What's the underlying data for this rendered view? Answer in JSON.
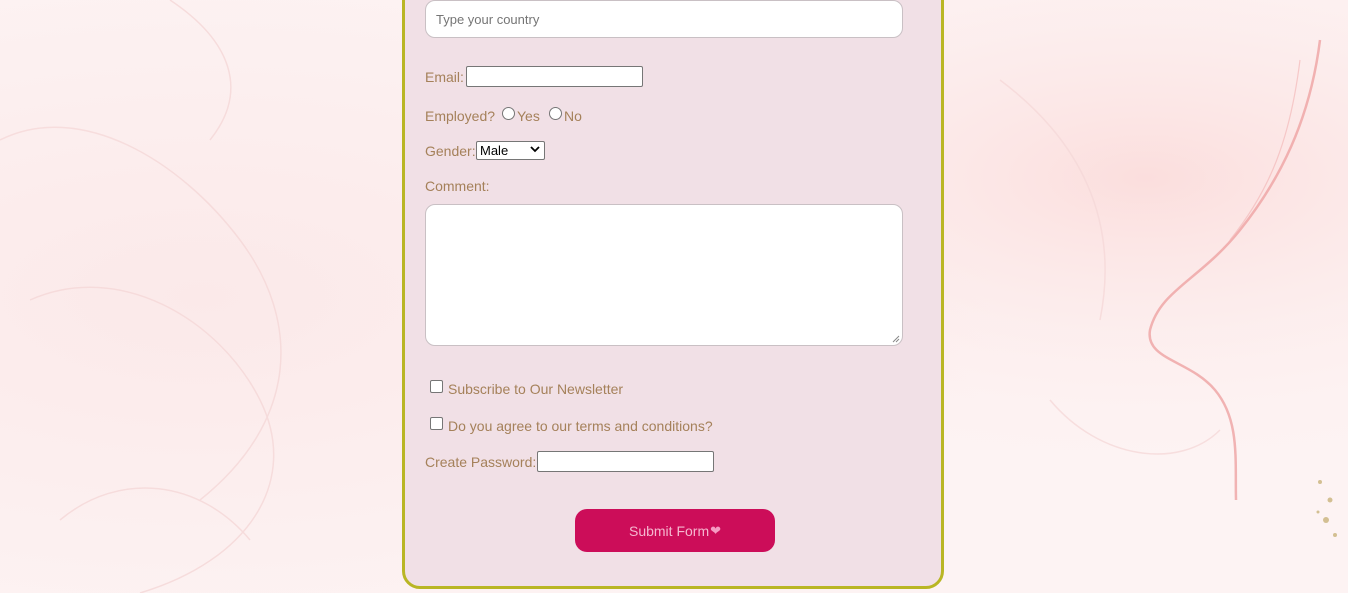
{
  "form": {
    "country": {
      "placeholder": "Type your country",
      "value": ""
    },
    "email": {
      "label": "Email:",
      "value": ""
    },
    "employed": {
      "label": "Employed?",
      "options": [
        "Yes",
        "No"
      ]
    },
    "gender": {
      "label": "Gender:",
      "selected": "Male"
    },
    "comment": {
      "label": "Comment:",
      "value": ""
    },
    "newsletter": {
      "label": "Subscribe to Our Newsletter",
      "checked": false
    },
    "terms": {
      "label": "Do you agree to our terms and conditions?",
      "checked": false
    },
    "password": {
      "label": "Create Password:",
      "value": ""
    },
    "submit": {
      "label": "Submit Form"
    }
  },
  "colors": {
    "card_border": "#b9b624",
    "card_bg": "#f1e0e6",
    "label_text": "#a5815a",
    "submit_bg": "#cc0d59"
  }
}
